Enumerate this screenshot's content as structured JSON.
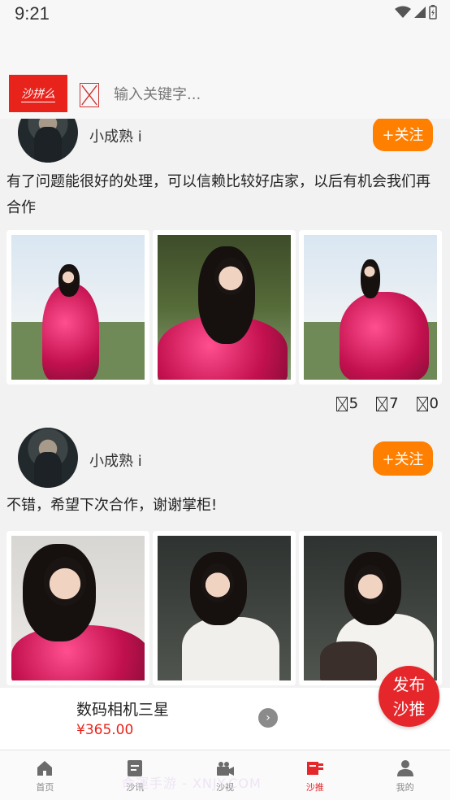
{
  "status_bar": {
    "time": "9:21"
  },
  "header": {
    "logo_text": "沙拼么",
    "search_placeholder": "输入关键字..."
  },
  "posts": [
    {
      "username": "小成熟 i",
      "follow_label": "+关注",
      "text": "有了问题能很好的处理，可以信赖比较好店家，以后有机会我们再合作",
      "stats": [
        "5",
        "7",
        "0"
      ]
    },
    {
      "username": "小成熟 i",
      "follow_label": "+关注",
      "text": "不错，希望下次合作，谢谢掌柜!"
    }
  ],
  "product": {
    "name": "数码相机三星",
    "price": "¥365.00"
  },
  "publish_button": {
    "line1": "发布",
    "line2": "沙推"
  },
  "bottom_nav": [
    {
      "label": "首页",
      "icon": "home-icon",
      "active": false
    },
    {
      "label": "沙讯",
      "icon": "news-icon",
      "active": false
    },
    {
      "label": "沙视",
      "icon": "video-icon",
      "active": false
    },
    {
      "label": "沙推",
      "icon": "push-icon",
      "active": true
    },
    {
      "label": "我的",
      "icon": "profile-icon",
      "active": false
    }
  ],
  "watermark": "命運手游 - XNJY.COM",
  "colors": {
    "accent": "#e5262a",
    "follow": "#ff7f00",
    "price": "#e8231b"
  }
}
